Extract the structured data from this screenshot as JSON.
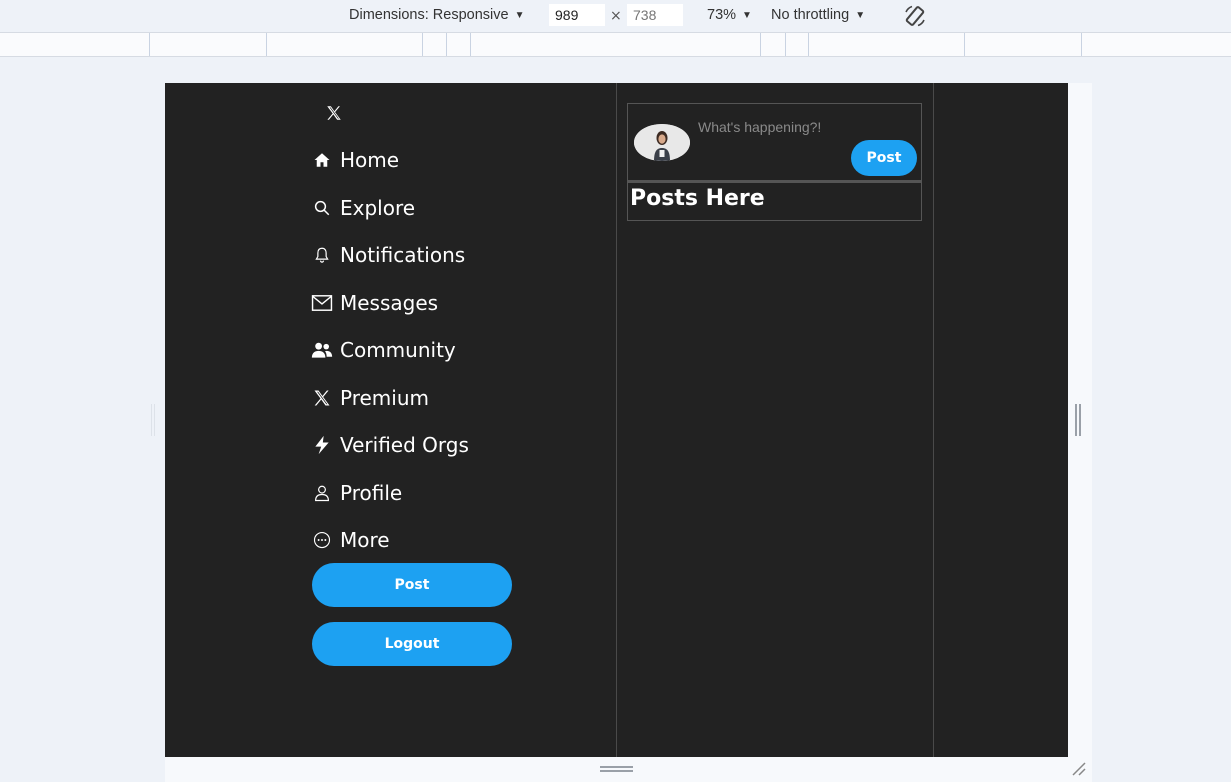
{
  "devtools": {
    "dimensions_label": "Dimensions: Responsive",
    "width_value": "989",
    "height_placeholder": "738",
    "times": "×",
    "zoom": "73%",
    "throttling": "No throttling",
    "caret": "▼"
  },
  "app": {
    "logo_icon": "x-logo-icon",
    "nav": [
      {
        "label": "Home",
        "icon": "home-icon"
      },
      {
        "label": "Explore",
        "icon": "search-icon"
      },
      {
        "label": "Notifications",
        "icon": "bell-icon"
      },
      {
        "label": "Messages",
        "icon": "envelope-icon"
      },
      {
        "label": "Community",
        "icon": "people-icon"
      },
      {
        "label": "Premium",
        "icon": "x-logo-icon"
      },
      {
        "label": "Verified Orgs",
        "icon": "lightning-icon"
      },
      {
        "label": "Profile",
        "icon": "person-icon"
      },
      {
        "label": "More",
        "icon": "more-circle-icon"
      }
    ],
    "post_button": "Post",
    "logout_button": "Logout",
    "composer": {
      "placeholder": "What's happening?!",
      "post_button": "Post"
    },
    "feed_title": "Posts Here"
  },
  "colors": {
    "background": "#222222",
    "accent": "#1da1f2",
    "text": "#ffffff"
  }
}
